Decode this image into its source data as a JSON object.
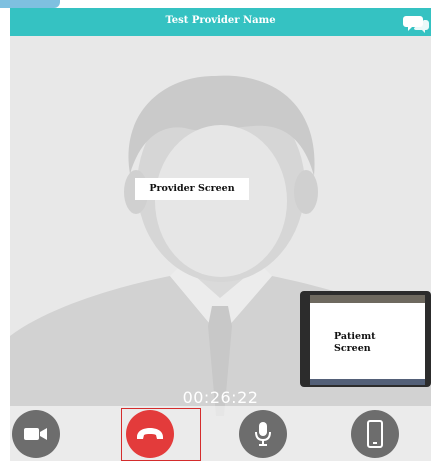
{
  "header": {
    "title": "Test Provider Name",
    "chat_icon": "chat-bubbles-icon"
  },
  "main": {
    "provider_label": "Provider Screen",
    "patient_label_line1": "Patiemt",
    "patient_label_line2": "Screen"
  },
  "call": {
    "timer": "00:26:22"
  },
  "controls": [
    {
      "name": "video-camera-icon"
    },
    {
      "name": "end-call-icon"
    },
    {
      "name": "microphone-icon"
    },
    {
      "name": "phone-icon"
    }
  ],
  "colors": {
    "header": "#35c2c2",
    "end_call": "#e33b3b",
    "control_bg": "#6d6d6d"
  }
}
